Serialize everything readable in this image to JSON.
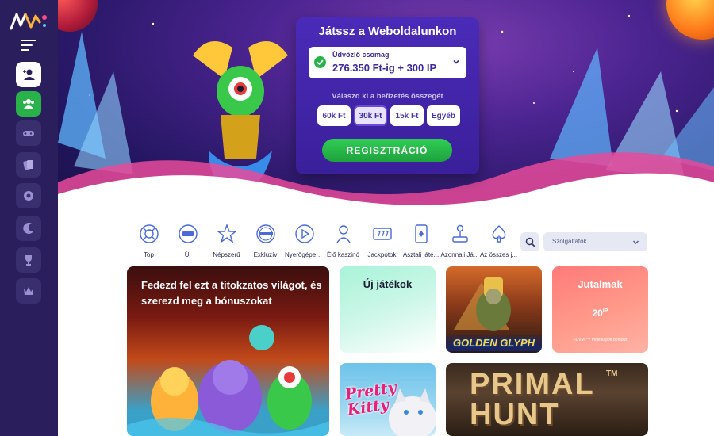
{
  "promo": {
    "title": "Játssz a Weboldalunkon",
    "bonus_label": "Üdvözlő csomag",
    "bonus_amount": "276.350 Ft-ig + 300 IP",
    "payment_label": "Válaszd ki a befizetés összegét",
    "amounts": [
      "60k Ft",
      "30k Ft",
      "15k Ft",
      "Egyéb"
    ],
    "selected_amount": "30k Ft",
    "register_label": "REGISZTRÁCIÓ"
  },
  "categories": [
    {
      "label": "Top",
      "icon": "lifebuoy-icon"
    },
    {
      "label": "Új",
      "icon": "new-badge-icon"
    },
    {
      "label": "Népszerű",
      "icon": "star-icon"
    },
    {
      "label": "Exkluzív",
      "icon": "exclusive-badge-icon"
    },
    {
      "label": "Nyerőgépes...",
      "icon": "play-icon"
    },
    {
      "label": "Élő kaszinó",
      "icon": "dealer-icon"
    },
    {
      "label": "Jackpotok",
      "icon": "slot-777-icon"
    },
    {
      "label": "Asztali játé...",
      "icon": "card-icon"
    },
    {
      "label": "Azonnali Já...",
      "icon": "joystick-icon"
    },
    {
      "label": "Az összes j...",
      "icon": "spade-icon"
    }
  ],
  "provider_select": {
    "placeholder": "Szolgáltatók"
  },
  "tiles": {
    "featured_title": "Fedezd fel ezt a titokzatos világot, és szerezd meg a bónuszokat",
    "new_games": "Új játékok",
    "golden_glyph": "GOLDEN GLYPH",
    "rewards_title": "Jutalmak",
    "rewards_value": "20",
    "rewards_unit": "IP",
    "rewards_note": "FDVM**** most kapott bónuszt",
    "pretty_kitty": "Pretty Kitty",
    "primal_hunt": "PRIMAL HUNT",
    "primal_tm": "TM"
  },
  "sidebar": {
    "items": [
      "add-user-icon",
      "users-icon",
      "gamepad-icon",
      "cards-icon",
      "chip-icon",
      "moon-icon",
      "trophy-icon",
      "crown-icon"
    ]
  },
  "colors": {
    "sidebar_bg": "#2a1f5c",
    "accent_green": "#2ab24a",
    "promo_bg": "#4a2bb8",
    "rewards_bg": "#ff7a7a"
  }
}
